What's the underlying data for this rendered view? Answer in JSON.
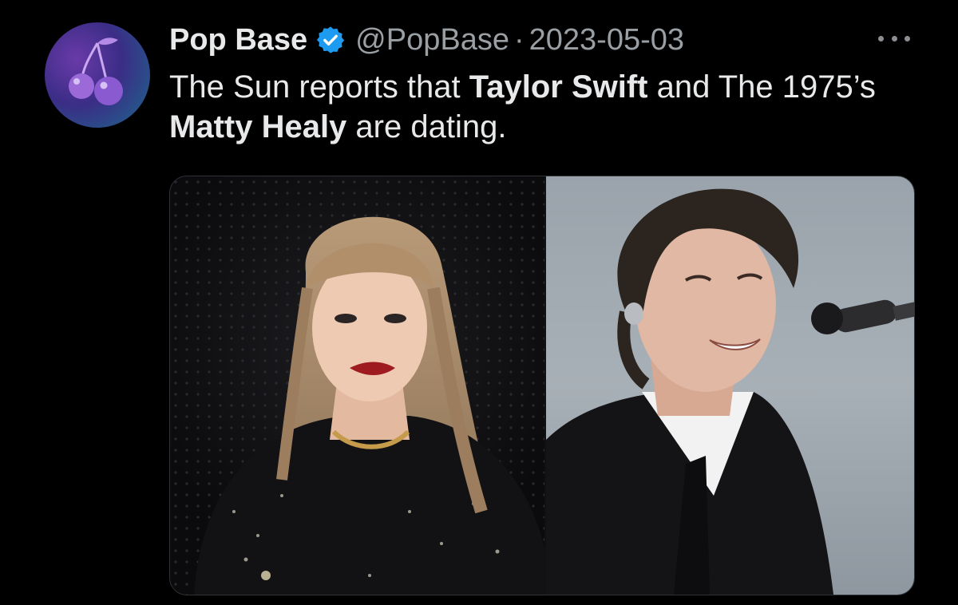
{
  "tweet": {
    "author": {
      "display_name": "Pop Base",
      "handle": "@PopBase",
      "verified": true,
      "avatar_icon": "cherry-icon"
    },
    "separator": "·",
    "date": "2023-05-03",
    "text": {
      "part1": "The Sun reports that ",
      "bold1": "Taylor Swift",
      "part2": " and The 1975’s ",
      "bold2": "Matty Healy",
      "part3": " are dating."
    },
    "more_icon": "more-horizontal-icon",
    "media": [
      {
        "subject": "photo-of-taylor-swift"
      },
      {
        "subject": "photo-of-matty-healy"
      }
    ]
  },
  "colors": {
    "background": "#000000",
    "text": "#e7e9ea",
    "secondary_text": "#9a9fa4",
    "verified_badge": "#1d9bf0"
  }
}
